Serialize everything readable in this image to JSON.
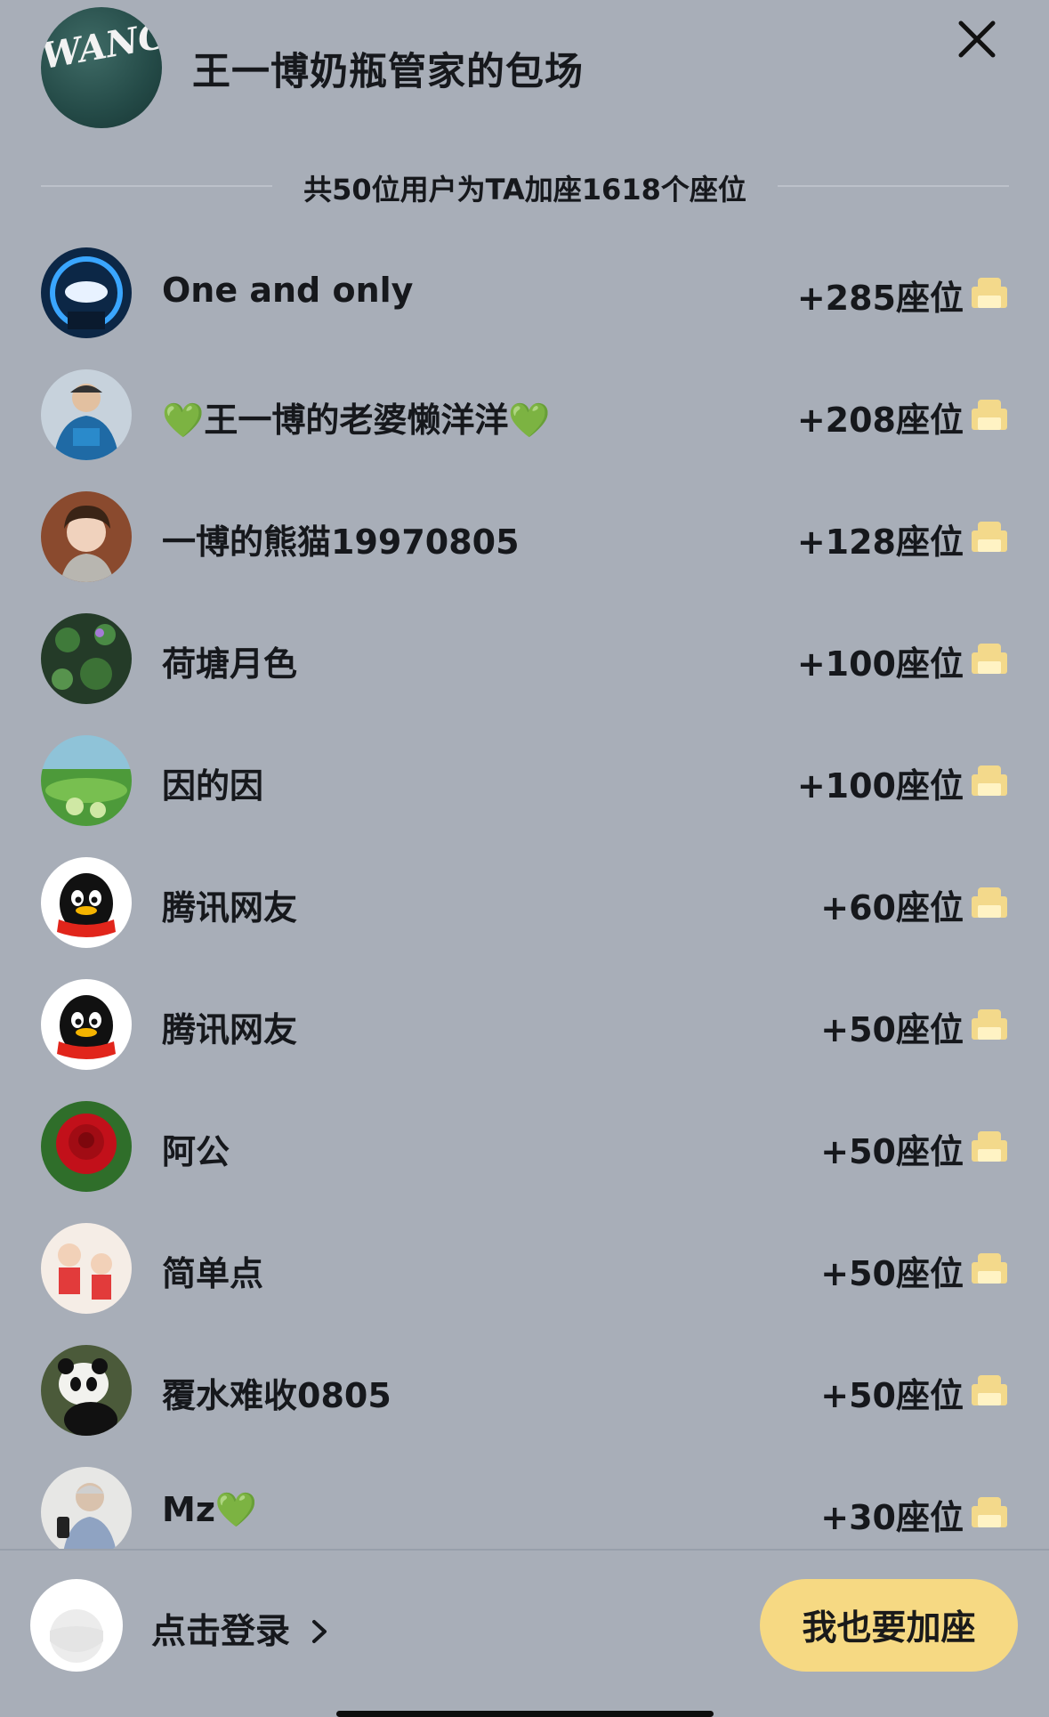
{
  "header": {
    "title": "王一博奶瓶管家的包场",
    "host_avatar_text": "WANG YIBO"
  },
  "summary": "共50位用户为TA加座1618个座位",
  "supporters": [
    {
      "name": "One and only",
      "seats": "+285座位",
      "avatar": "photo-car"
    },
    {
      "name": "💚王一博的老婆懒洋洋💚",
      "seats": "+208座位",
      "avatar": "photo-person-cap"
    },
    {
      "name": "一博的熊猫19970805",
      "seats": "+128座位",
      "avatar": "photo-person-curly"
    },
    {
      "name": "荷塘月色",
      "seats": "+100座位",
      "avatar": "photo-lotus-pond"
    },
    {
      "name": "因的因",
      "seats": "+100座位",
      "avatar": "photo-green-landscape"
    },
    {
      "name": "腾讯网友",
      "seats": "+60座位",
      "avatar": "qq-penguin"
    },
    {
      "name": "腾讯网友",
      "seats": "+50座位",
      "avatar": "qq-penguin"
    },
    {
      "name": "阿公",
      "seats": "+50座位",
      "avatar": "photo-red-rose"
    },
    {
      "name": "简单点",
      "seats": "+50座位",
      "avatar": "photo-cartoon-kids"
    },
    {
      "name": "覆水难收0805",
      "seats": "+50座位",
      "avatar": "photo-panda"
    },
    {
      "name": "Mz💚",
      "seats": "+30座位",
      "avatar": "photo-person-phone"
    }
  ],
  "footer": {
    "login_label": "点击登录",
    "join_button": "我也要加座"
  },
  "colors": {
    "background": "#a8aeb8",
    "accent_button": "#f6d983",
    "sofa_icon": "#f3d98b"
  }
}
